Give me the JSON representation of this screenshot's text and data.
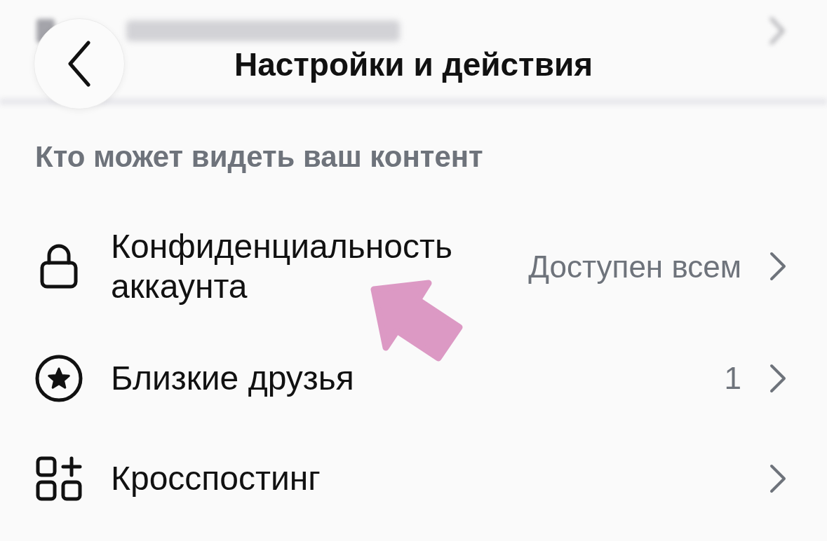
{
  "header": {
    "title": "Настройки и действия"
  },
  "section": {
    "heading": "Кто может видеть ваш контент",
    "items": [
      {
        "label": "Конфиденциальность аккаунта",
        "value": "Доступен всем"
      },
      {
        "label": "Близкие друзья",
        "value": "1"
      },
      {
        "label": "Кросспостинг"
      }
    ]
  }
}
